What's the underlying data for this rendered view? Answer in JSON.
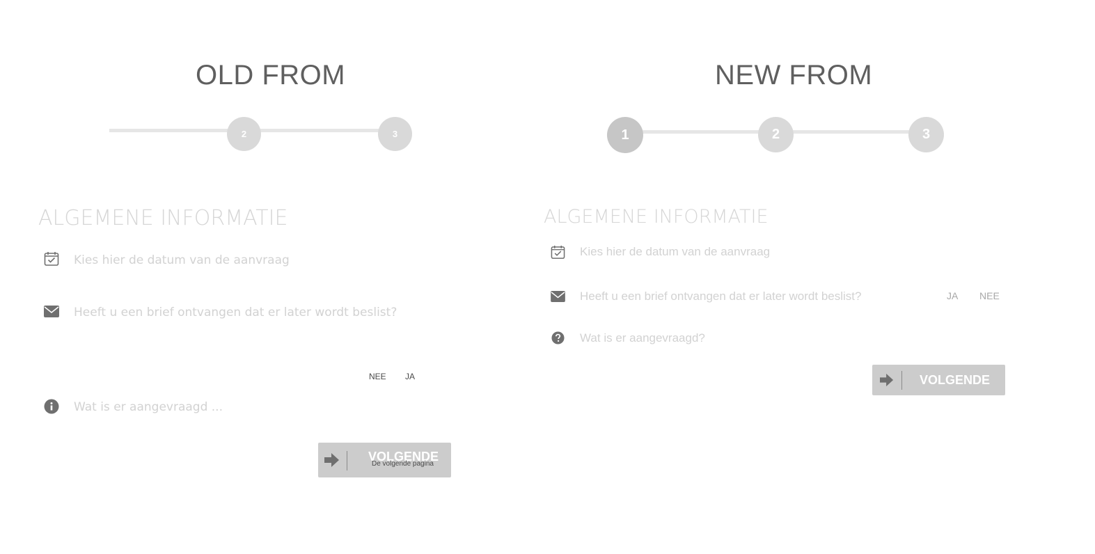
{
  "old_form": {
    "title": "OLD FROM",
    "steps": [
      "2",
      "3"
    ],
    "section_title": "ALGEMENE INFORMATIE",
    "questions": {
      "date": "Kies hier de datum van de aanvraag",
      "letter": "Heeft u een brief ontvangen dat er later wordt beslist?",
      "requested": "Wat is er aangevraagd ..."
    },
    "options": {
      "no": "NEE",
      "yes": "JA"
    },
    "next_button": {
      "label": "VOLGENDE",
      "sublabel": "De volgende pagina"
    }
  },
  "new_form": {
    "title": "NEW FROM",
    "steps": [
      "1",
      "2",
      "3"
    ],
    "active_step": "1",
    "section_title": "ALGEMENE INFORMATIE",
    "questions": {
      "date": "Kies hier de datum van de aanvraag",
      "letter": "Heeft u een brief ontvangen dat er later wordt beslist?",
      "requested": "Wat is er aangevraagd?"
    },
    "options": {
      "yes": "JA",
      "no": "NEE"
    },
    "next_button": {
      "label": "VOLGENDE"
    }
  },
  "icons": [
    "calendar-check-icon",
    "envelope-icon",
    "info-icon",
    "question-circle-icon",
    "arrow-right-icon"
  ],
  "colors": {
    "title": "#5f5f5f",
    "step": "#d9d9d9",
    "step_active": "#c6c6c6",
    "button": "#cccccc",
    "icon": "#6f6f6f"
  }
}
